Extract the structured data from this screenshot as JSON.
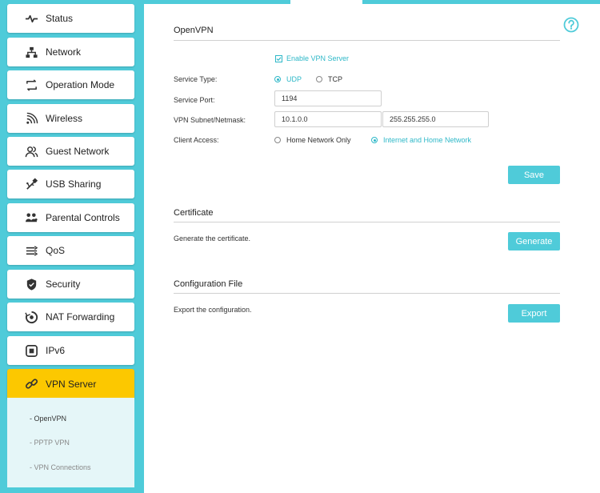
{
  "sidebar": {
    "items": [
      {
        "label": "Status",
        "icon": "activity-icon"
      },
      {
        "label": "Network",
        "icon": "network-icon"
      },
      {
        "label": "Operation Mode",
        "icon": "operation-mode-icon"
      },
      {
        "label": "Wireless",
        "icon": "wifi-icon"
      },
      {
        "label": "Guest Network",
        "icon": "users-icon"
      },
      {
        "label": "USB Sharing",
        "icon": "usb-icon"
      },
      {
        "label": "Parental Controls",
        "icon": "family-icon"
      },
      {
        "label": "QoS",
        "icon": "qos-icon"
      },
      {
        "label": "Security",
        "icon": "shield-icon"
      },
      {
        "label": "NAT Forwarding",
        "icon": "nat-forwarding-icon"
      },
      {
        "label": "IPv6",
        "icon": "ipv6-icon"
      },
      {
        "label": "VPN Server",
        "icon": "link-icon"
      }
    ],
    "active_index": 11,
    "subitems": [
      {
        "label": "- OpenVPN"
      },
      {
        "label": "- PPTP VPN"
      },
      {
        "label": "- VPN Connections"
      }
    ],
    "active_subitem": 0
  },
  "openvpn": {
    "title": "OpenVPN",
    "enable_label": "Enable VPN Server",
    "enabled": true,
    "service_type": {
      "label": "Service Type:",
      "options": [
        "UDP",
        "TCP"
      ],
      "selected": "UDP"
    },
    "service_port": {
      "label": "Service Port:",
      "value": "1194"
    },
    "subnet": {
      "label": "VPN Subnet/Netmask:",
      "subnet_value": "10.1.0.0",
      "netmask_value": "255.255.255.0"
    },
    "client_access": {
      "label": "Client Access:",
      "options": [
        "Home Network Only",
        "Internet and Home Network"
      ],
      "selected": "Internet and Home Network"
    },
    "save_label": "Save"
  },
  "certificate": {
    "title": "Certificate",
    "description": "Generate the certificate.",
    "button_label": "Generate"
  },
  "config_file": {
    "title": "Configuration File",
    "description": "Export the configuration.",
    "button_label": "Export"
  },
  "colors": {
    "accent": "#4fcbd9",
    "active_nav": "#fcc800",
    "subnav_bg": "#e5f6f8"
  }
}
